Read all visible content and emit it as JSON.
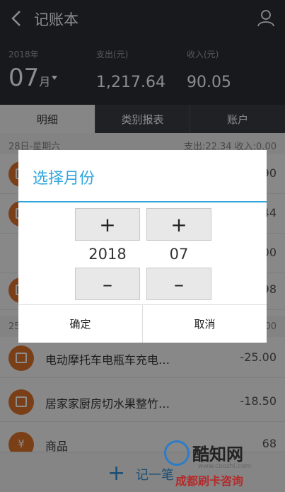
{
  "header": {
    "title": "记账本",
    "year_label": "2018年",
    "month_value": "07",
    "month_unit": "月",
    "expense_label": "支出(元)",
    "expense_value": "1,217.64",
    "income_label": "收入(元)",
    "income_value": "90.05"
  },
  "tabs": [
    {
      "label": "明细"
    },
    {
      "label": "类别报表"
    },
    {
      "label": "账户"
    }
  ],
  "list": {
    "day1": {
      "date": "28日-星期六",
      "summary": "支出:22.34 收入:0.00"
    },
    "partial_amounts": [
      "90",
      "44",
      "00",
      "98",
      "00"
    ],
    "day2_prefix": "25",
    "rows": [
      {
        "name": "电动摩托车电瓶车充电…",
        "amount": "-25.00",
        "icon": "bag-icon"
      },
      {
        "name": "居家家厨房切水果整竹…",
        "amount": "-18.50",
        "icon": "bag-icon"
      },
      {
        "name": "商品",
        "amount": "68",
        "icon": "yen-icon"
      }
    ]
  },
  "add_bar": {
    "label": "记一笔"
  },
  "dialog": {
    "title": "选择月份",
    "year_value": "2018",
    "month_value": "07",
    "plus_symbol": "+",
    "minus_symbol": "–",
    "confirm_label": "确定",
    "cancel_label": "取消"
  },
  "watermark": {
    "name": "酷知网",
    "url": "www.coozhi.com",
    "sub": "成都刷卡咨询"
  },
  "colors": {
    "accent": "#2fa6dc",
    "header_bg": "#2c2f36",
    "icon_orange": "#e0742a"
  }
}
